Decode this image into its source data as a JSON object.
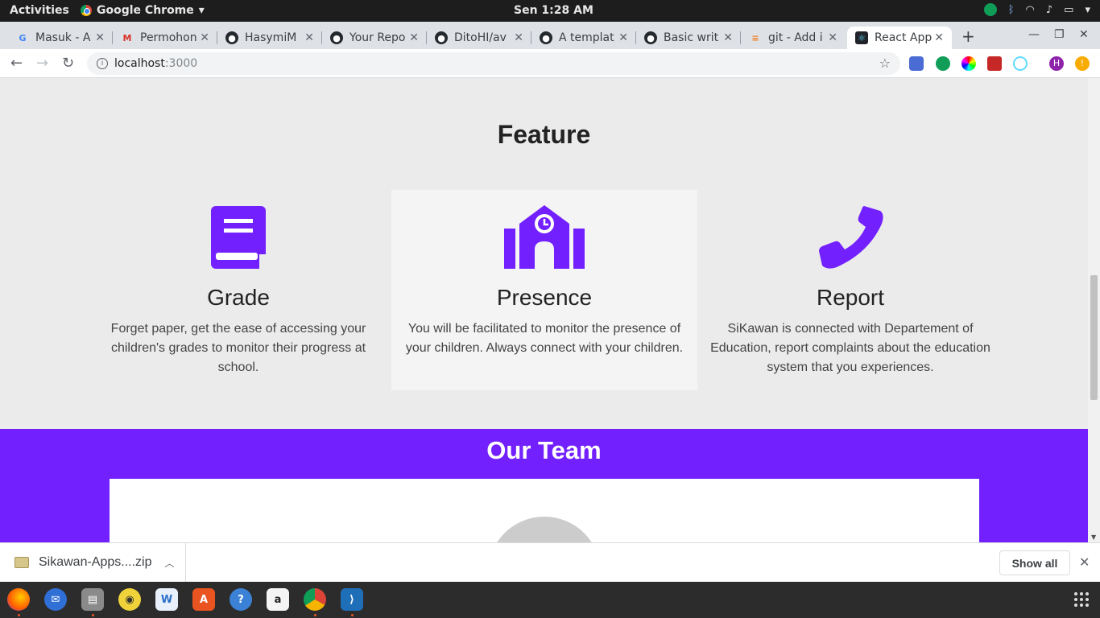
{
  "topbar": {
    "activities": "Activities",
    "app_name": "Google Chrome",
    "clock": "Sen  1:28 AM"
  },
  "tabs": [
    {
      "title": "Masuk - A",
      "icon": "google-icon",
      "color": "#4285f4"
    },
    {
      "title": "Permohon",
      "icon": "gmail-icon",
      "color": "#d93025"
    },
    {
      "title": "HasymiM",
      "icon": "github-icon",
      "color": "#24292e"
    },
    {
      "title": "Your Repo",
      "icon": "github-icon",
      "color": "#24292e"
    },
    {
      "title": "DitoHI/av",
      "icon": "github-icon",
      "color": "#24292e"
    },
    {
      "title": "A templat",
      "icon": "github-icon",
      "color": "#24292e"
    },
    {
      "title": "Basic writ",
      "icon": "github-icon",
      "color": "#24292e"
    },
    {
      "title": "git - Add i",
      "icon": "stackoverflow-icon",
      "color": "#f48024"
    },
    {
      "title": "React App",
      "icon": "react-icon",
      "color": "#61dafb",
      "active": true
    }
  ],
  "address_bar": {
    "host": "localhost",
    "port": ":3000"
  },
  "page": {
    "feature_heading": "Feature",
    "features": [
      {
        "title": "Grade",
        "icon": "book-icon",
        "description": "Forget paper, get the ease of accessing your children's grades to monitor their progress at school."
      },
      {
        "title": "Presence",
        "icon": "school-icon",
        "description": "You will be facilitated to monitor the presence of your children. Always connect with your children."
      },
      {
        "title": "Report",
        "icon": "phone-icon",
        "description": "SiKawan is connected with Departement of Education, report complaints about the education system that you experiences."
      }
    ],
    "team_heading": "Our Team"
  },
  "downloads": {
    "file_name": "Sikawan-Apps....zip",
    "show_all": "Show all"
  },
  "colors": {
    "accent": "#7320ff",
    "feature_bg": "#ebebeb",
    "card_highlight": "#f4f4f4"
  },
  "dock": {
    "apps": [
      "firefox-icon",
      "thunderbird-icon",
      "files-icon",
      "rhythmbox-icon",
      "libreoffice-writer-icon",
      "software-center-icon",
      "help-icon",
      "amazon-icon",
      "chrome-icon",
      "vscode-icon"
    ]
  }
}
